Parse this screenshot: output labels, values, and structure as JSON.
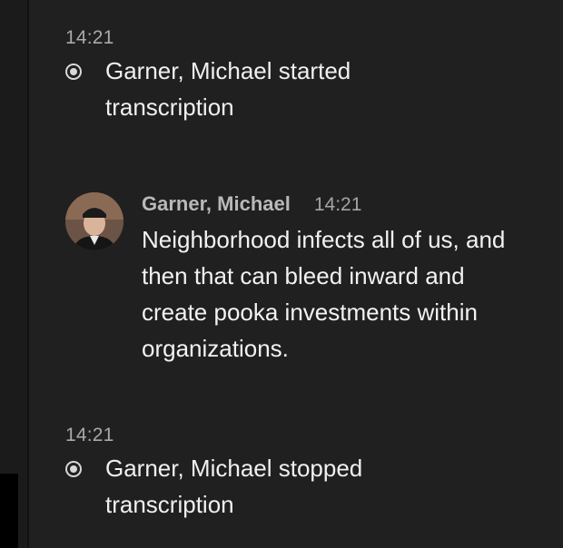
{
  "events": [
    {
      "time": "14:21",
      "text": "Garner, Michael started transcription"
    },
    {
      "time": "14:21",
      "text": "Garner, Michael stopped transcription"
    }
  ],
  "message": {
    "sender": "Garner, Michael",
    "time": "14:21",
    "text": "Neighborhood infects all of us, and then that can bleed inward and create pooka investments within organizations."
  },
  "icons": {
    "event_icon": "radio-record-icon",
    "avatar": "user-avatar"
  },
  "colors": {
    "background": "#202020",
    "text": "#f0f0f0",
    "muted": "#a9a9a9"
  }
}
